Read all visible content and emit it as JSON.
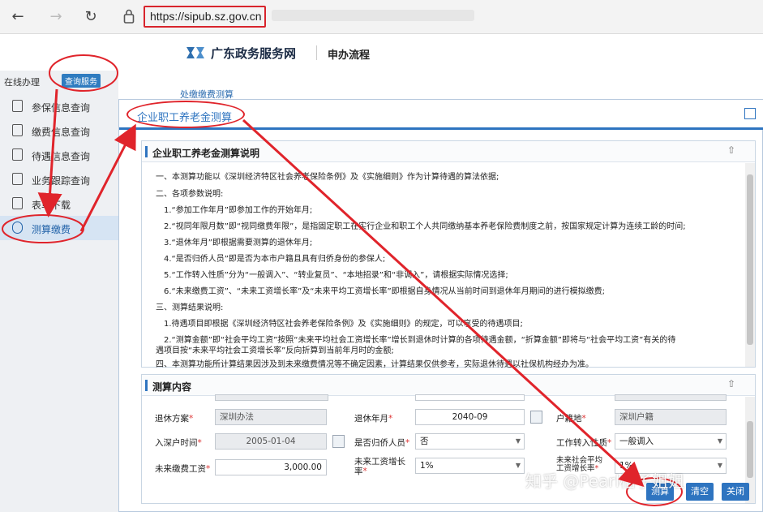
{
  "browser": {
    "url": "https://sipub.sz.gov.cn"
  },
  "site": {
    "title": "广东政务服务网",
    "flow": "申办流程"
  },
  "sidebar": {
    "title": "在线办理",
    "chip": "查询服务",
    "items": [
      {
        "label": "参保信息查询"
      },
      {
        "label": "缴费信息查询"
      },
      {
        "label": "待遇信息查询"
      },
      {
        "label": "业务跟踪查询"
      },
      {
        "label": "表单下载"
      },
      {
        "label": "测算缴费"
      }
    ]
  },
  "behind": {
    "crumb": "处缴缴费测算"
  },
  "modal": {
    "title": "企业职工养老金测算",
    "desc_panel": {
      "title": "企业职工养老金测算说明",
      "lines": [
        "一、本测算功能以《深圳经济特区社会养老保险条例》及《实施细则》作为计算待遇的算法依据;",
        "二、各项参数说明:",
        "1.“参加工作年月”即参加工作的开始年月;",
        "2.“视同年限月数”即“视同缴费年限”，是指固定职工在实行企业和职工个人共同缴纳基本养老保险费制度之前，按国家规定计算为连续工龄的时间;",
        "3.“退休年月”即根据需要测算的退休年月;",
        "4.“是否归侨人员”即是否为本市户籍且具有归侨身份的参保人;",
        "5.“工作转入性质”分为“一般调入”、“转业复员”、“本地招录”和“非调入”，请根据实际情况选择;",
        "6.“未来缴费工资”、“未来工资增长率”及“未来平均工资增长率”即根据自身情况从当前时间到退休年月期间的进行模拟缴费;",
        "三、测算结果说明:",
        "1.待遇项目即根据《深圳经济特区社会养老保险条例》及《实施细则》的规定，可以享受的待遇项目;",
        "2.“测算金额”即“社会平均工资”按照“未来平均社会工资增长率”增长到退休时计算的各项待遇金额，“折算金额”即将与“社会平均工资”有关的待",
        "遇项目按“未来平均社会工资增长率”反向折算到当前年月时的金额;",
        "四、本测算功能所计算结果因涉及到未来缴费情况等不确定因素，计算结果仅供参考，实际退休待遇以社保机构经办为准。"
      ]
    },
    "form_panel": {
      "title": "测算内容",
      "fields": {
        "retire_plan": {
          "label": "退休方案",
          "value": "深圳办法"
        },
        "retire_month": {
          "label": "退休年月",
          "value": "2040-09"
        },
        "hukou": {
          "label": "户籍地",
          "value": "深圳户籍"
        },
        "enter_date": {
          "label": "入深户时间",
          "value": "2005-01-04"
        },
        "overseas": {
          "label": "是否归侨人员",
          "value": "否"
        },
        "transfer": {
          "label": "工作转入性质",
          "value": "一般调入"
        },
        "future_wage": {
          "label": "未来缴费工资",
          "value": "3,000.00"
        },
        "wage_growth": {
          "label": "未来工资增长率",
          "value": "1%"
        },
        "avg_growth": {
          "label": "未来社会平均工资增长率",
          "value": "1%"
        }
      }
    },
    "buttons": {
      "calc": "测算",
      "clear": "清空",
      "close": "关闭"
    }
  },
  "watermark": "知乎 @Pearl桔子姐姐",
  "colors": {
    "accent": "#2e74c0",
    "annotation": "#e0242b"
  }
}
